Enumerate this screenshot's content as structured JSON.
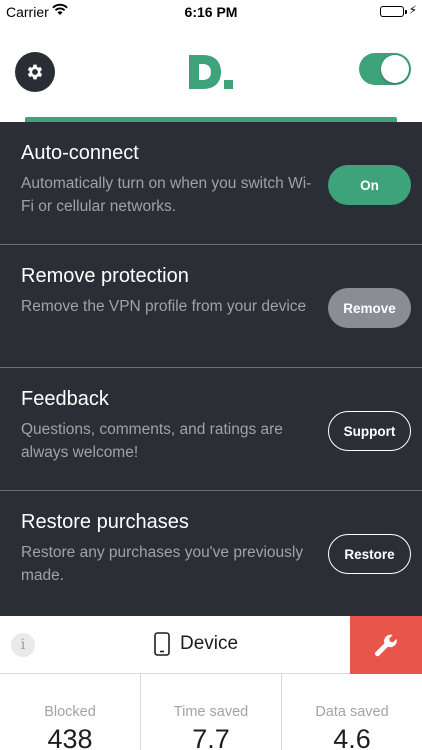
{
  "status_bar": {
    "carrier": "Carrier",
    "time": "6:16 PM"
  },
  "header": {
    "settings_icon": "gear-icon",
    "logo_icon": "d-logo",
    "main_toggle": "on",
    "colors": {
      "accent": "#3ea37a"
    }
  },
  "settings": [
    {
      "title": "Auto-connect",
      "description": "Automatically turn on when you switch Wi-Fi or cellular networks.",
      "button": "On"
    },
    {
      "title": "Remove protection",
      "description": "Remove the VPN profile from your device",
      "button": "Remove"
    },
    {
      "title": "Feedback",
      "description": "Questions, comments, and ratings are always welcome!",
      "button": "Support"
    },
    {
      "title": "Restore purchases",
      "description": "Restore any purchases you've previously made.",
      "button": "Restore"
    }
  ],
  "device_bar": {
    "info_label": "i",
    "device_name": "Device",
    "device_icon": "phone-icon",
    "tools_icon": "wrench-icon",
    "colors": {
      "tools_button": "#e8554b"
    }
  },
  "stats": [
    {
      "label": "Blocked",
      "value": "438"
    },
    {
      "label": "Time saved",
      "value": "7.7"
    },
    {
      "label": "Data saved",
      "value": "4.6"
    }
  ]
}
